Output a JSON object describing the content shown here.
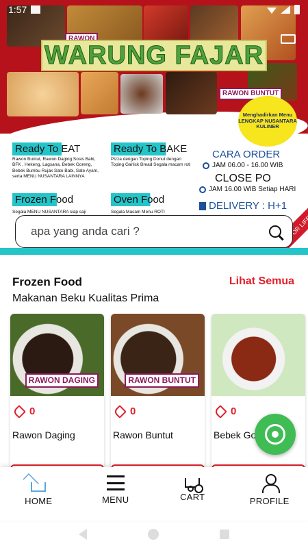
{
  "status_bar": {
    "time": "1:57"
  },
  "banner": {
    "brand": "WARUNG FAJAR",
    "photo_tag_1": "RAWON",
    "photo_tag_2": "RAWON BUNTUT",
    "badge": "Menghadirkan Menu LENGKAP NUSANTARA KULINER",
    "ready_eat": "Ready To EAT",
    "ready_eat_items": "Rawon Buntut, Rawon Daging Sosis Babi, BFK , Hekeng, Lagsana, Bebek Goreng, Bebek Bumbu Rujak Sate Babi, Sate Ayam, serta MENU NUSANTARA LAINNYA",
    "ready_bake": "Ready To BAKE",
    "ready_bake_items": "Pizza dengan Toping Donut dengan Toping Garlick Bread Segala macam roti",
    "frozen_food": "Frozen Food",
    "frozen_items": "Segala MENU NUSANTARA siap saji",
    "oven_food": "Oven Food",
    "oven_items": "Segala Macam Menu ROTI",
    "cara_order": "CARA ORDER",
    "order_hours": "JAM 06.00 - 16.00 WIB",
    "close_po": "CLOSE PO",
    "close_hours": "JAM 16.00 WIB Setiap HARI",
    "delivery": "DELIVERY : H+1",
    "ribbon": "OR LIFE"
  },
  "search": {
    "placeholder": "apa yang anda cari ?"
  },
  "section": {
    "title": "Frozen Food",
    "see_all": "Lihat Semua",
    "subtitle": "Makanan Beku Kualitas Prima"
  },
  "products": [
    {
      "name": "Rawon Daging",
      "likes": "0",
      "tag": "RAWON DAGING"
    },
    {
      "name": "Rawon Buntut",
      "likes": "0",
      "tag": "RAWON BUNTUT"
    },
    {
      "name": "Bebek Go",
      "likes": "0"
    }
  ],
  "nav": {
    "home": "HOME",
    "menu": "MENU",
    "cart": "CART",
    "profile": "PROFILE"
  },
  "colors": {
    "accent_red": "#e0202a",
    "banner_red": "#b5121b",
    "teal": "#25c4c8",
    "whatsapp_green": "#3fbd54",
    "home_blue": "#5aa7e0"
  },
  "icons": [
    "search-icon",
    "tag-icon",
    "whatsapp-icon",
    "home-icon",
    "menu-icon",
    "cart-icon",
    "profile-icon",
    "clock-icon"
  ]
}
